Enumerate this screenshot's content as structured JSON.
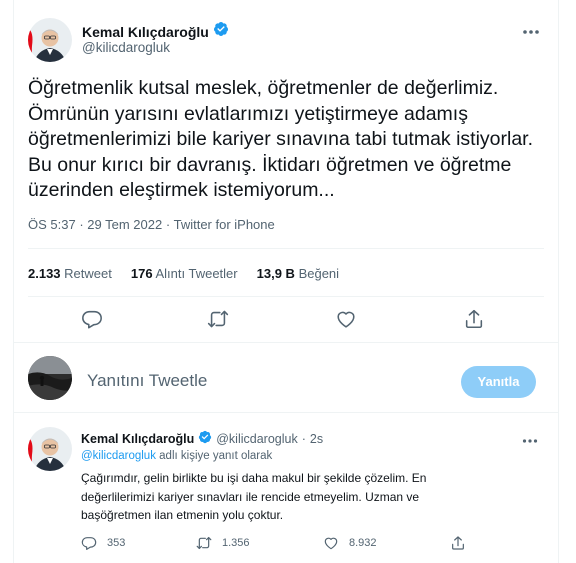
{
  "tweet": {
    "author_name": "Kemal Kılıçdaroğlu",
    "handle": "@kilicdarogluk",
    "text": "Öğretmenlik kutsal meslek, öğretmenler de değerlimiz. Ömrünün yarısını evlatlarımızı yetiştirmeye adamış öğretmenlerimizi bile kariyer sınavına tabi tutmak istiyorlar. Bu onur kırıcı bir davranış. İktidarı öğretmen ve öğretme üzerinden eleştirmek istemiyorum...",
    "time": "ÖS 5:37",
    "date": "29 Tem 2022",
    "source": "Twitter for iPhone",
    "separator": "·",
    "more_icon": "more-icon"
  },
  "stats": {
    "retweets_value": "2.133",
    "retweets_label": "Retweet",
    "quotes_value": "176",
    "quotes_label": "Alıntı Tweetler",
    "likes_value": "13,9 B",
    "likes_label": "Beğeni"
  },
  "actions": [
    "reply-icon",
    "retweet-icon",
    "like-icon",
    "share-icon"
  ],
  "compose": {
    "placeholder": "Yanıtını Tweetle",
    "button_label": "Yanıtla"
  },
  "reply": {
    "author_name": "Kemal Kılıçdaroğlu",
    "handle": "@kilicdarogluk",
    "separator": "·",
    "age": "2s",
    "replying_to_handle": "@kilicdarogluk",
    "replying_to_suffix": " adlı kişiye yanıt olarak",
    "text": "Çağırımdır, gelin birlikte bu işi daha makul bir şekilde çözelim. En değerlilerimizi kariyer sınavları ile rencide etmeyelim. Uzman ve başöğretmen ilan etmenin yolu çoktur.",
    "reply_count": "353",
    "retweet_count": "1.356",
    "like_count": "8.932"
  },
  "colors": {
    "accent": "#1d9bf0",
    "accent_disabled": "#8ecdf8",
    "muted_text": "#536471",
    "divider": "#eff3f4",
    "avatar_flag_red": "#e30a17"
  }
}
